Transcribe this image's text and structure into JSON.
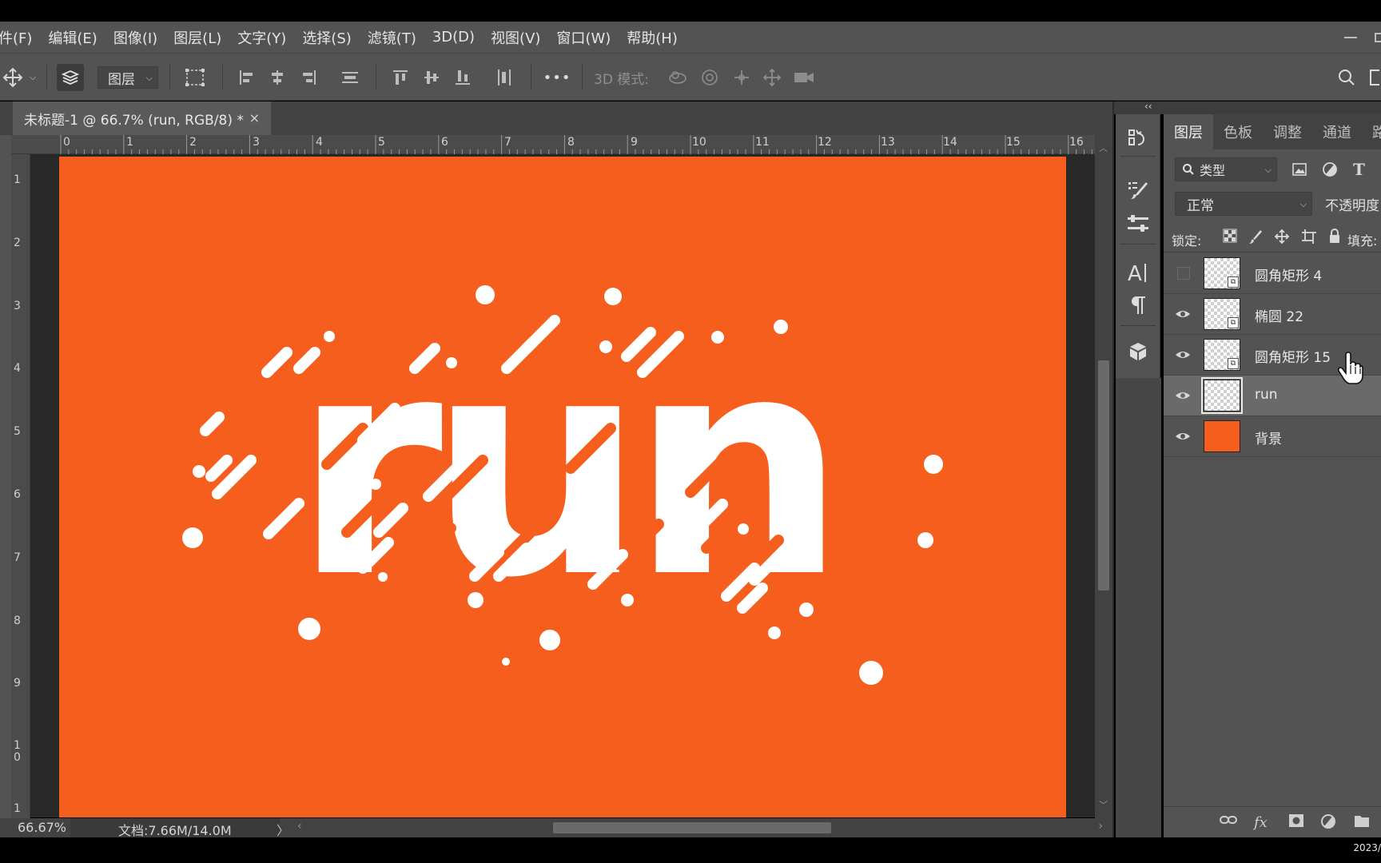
{
  "menubar": {
    "items": [
      "件(F)",
      "编辑(E)",
      "图像(I)",
      "图层(L)",
      "文字(Y)",
      "选择(S)",
      "滤镜(T)",
      "3D(D)",
      "视图(V)",
      "窗口(W)",
      "帮助(H)"
    ]
  },
  "options": {
    "auto_select_target": "图层",
    "mode_3d_label": "3D 模式:",
    "more_label": "•••"
  },
  "document": {
    "tab_title": "未标题-1 @ 66.7% (run, RGB/8) *",
    "close_glyph": "×",
    "canvas_text": "run",
    "canvas_color": "#f65e1e",
    "ruler_top": [
      "0",
      "1",
      "2",
      "3",
      "4",
      "5",
      "6",
      "7",
      "8",
      "9",
      "10",
      "11",
      "12",
      "13",
      "14",
      "15",
      "16"
    ],
    "ruler_left": [
      "1",
      "2",
      "3",
      "4",
      "5",
      "6",
      "7",
      "8",
      "9",
      "1\n0",
      "1"
    ]
  },
  "status": {
    "zoom": "66.67%",
    "doc_info": "文档:7.66M/14.0M",
    "arrow": "〉"
  },
  "layers_panel": {
    "tabs": [
      "图层",
      "色板",
      "调整",
      "通道",
      "路"
    ],
    "filter_label": "类型",
    "blend_mode": "正常",
    "opacity_label": "不透明度:",
    "lock_label": "锁定:",
    "fill_label": "填充:",
    "layers": [
      {
        "name": "圆角矩形 4",
        "visible": false,
        "thumb": "checker",
        "smart": true,
        "selected": false
      },
      {
        "name": "椭圆 22",
        "visible": true,
        "thumb": "checker",
        "smart": true,
        "selected": false
      },
      {
        "name": "圆角矩形 15",
        "visible": true,
        "thumb": "checker",
        "smart": true,
        "selected": false
      },
      {
        "name": "run",
        "visible": true,
        "thumb": "checker",
        "smart": false,
        "selected": true
      },
      {
        "name": "背景",
        "visible": true,
        "thumb": "orange",
        "smart": false,
        "selected": false
      }
    ]
  },
  "clock": "2023/"
}
